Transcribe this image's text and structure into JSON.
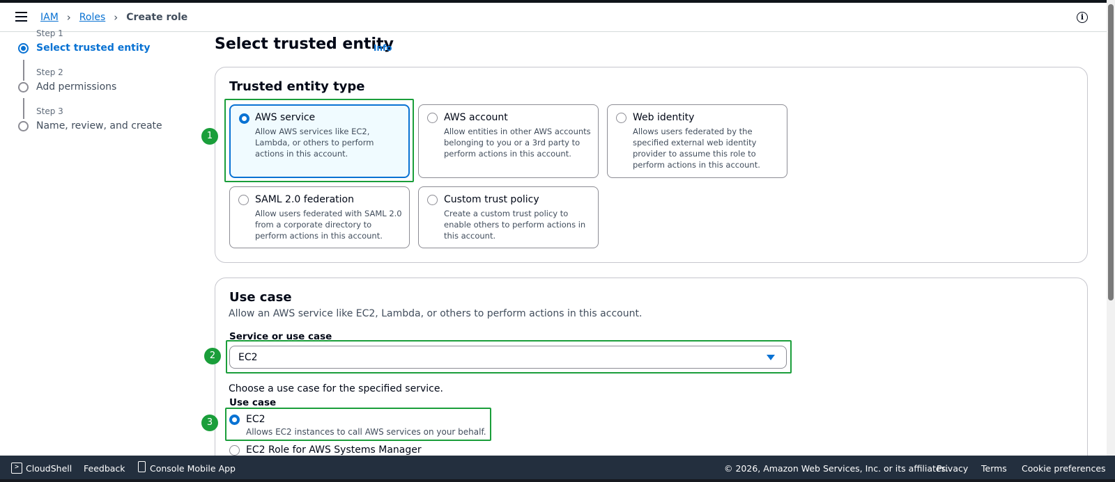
{
  "breadcrumb": {
    "root": "IAM",
    "parent": "Roles",
    "current": "Create role"
  },
  "steps": [
    {
      "label": "Step 1",
      "name": "Select trusted entity",
      "active": true
    },
    {
      "label": "Step 2",
      "name": "Add permissions",
      "active": false
    },
    {
      "label": "Step 3",
      "name": "Name, review, and create",
      "active": false
    }
  ],
  "page": {
    "title": "Select trusted entity",
    "info": "Info"
  },
  "trusted": {
    "title": "Trusted entity type",
    "options": [
      {
        "title": "AWS service",
        "desc": "Allow AWS services like EC2, Lambda, or others to perform actions in this account.",
        "selected": true
      },
      {
        "title": "AWS account",
        "desc": "Allow entities in other AWS accounts belonging to you or a 3rd party to perform actions in this account.",
        "selected": false
      },
      {
        "title": "Web identity",
        "desc": "Allows users federated by the specified external web identity provider to assume this role to perform actions in this account.",
        "selected": false
      },
      {
        "title": "SAML 2.0 federation",
        "desc": "Allow users federated with SAML 2.0 from a corporate directory to perform actions in this account.",
        "selected": false
      },
      {
        "title": "Custom trust policy",
        "desc": "Create a custom trust policy to enable others to perform actions in this account.",
        "selected": false
      }
    ]
  },
  "usecase": {
    "title": "Use case",
    "desc": "Allow an AWS service like EC2, Lambda, or others to perform actions in this account.",
    "service_label": "Service or use case",
    "service_value": "EC2",
    "choose_text": "Choose a use case for the specified service.",
    "usecase_label": "Use case",
    "options": [
      {
        "title": "EC2",
        "desc": "Allows EC2 instances to call AWS services on your behalf.",
        "selected": true
      },
      {
        "title": "EC2 Role for AWS Systems Manager",
        "desc": "",
        "selected": false
      }
    ]
  },
  "annotations": [
    "1",
    "2",
    "3"
  ],
  "footer": {
    "cloudshell": "CloudShell",
    "feedback": "Feedback",
    "mobile_app": "Console Mobile App",
    "copyright": "© 2026, Amazon Web Services, Inc. or its affiliates.",
    "privacy": "Privacy",
    "terms": "Terms",
    "cookies": "Cookie preferences"
  },
  "colors": {
    "accent": "#0972d3",
    "annotation": "#1a9e3a",
    "footer_bg": "#232f3e"
  }
}
